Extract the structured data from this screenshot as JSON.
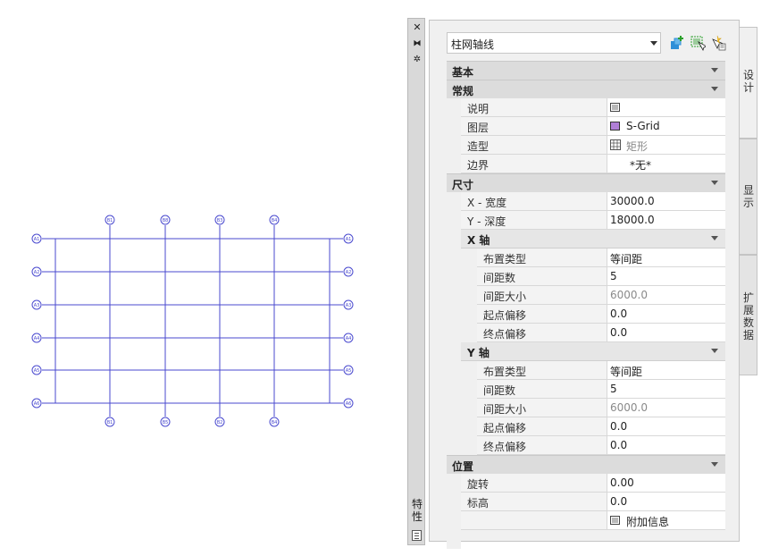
{
  "drawing": {
    "grid_top_labels": [
      "B1",
      "B8",
      "B3",
      "B4"
    ],
    "grid_bottom_labels": [
      "B1",
      "B5",
      "B2",
      "B4"
    ],
    "grid_left_labels": [
      "A1",
      "A2",
      "A3",
      "A4",
      "A5",
      "A6"
    ],
    "grid_right_labels": [
      "A1",
      "A2",
      "A3",
      "A4",
      "A5",
      "A6"
    ],
    "line_color": "#4a4acf"
  },
  "palette": {
    "title": "特性",
    "close_icon": "close-icon",
    "pin_icon": "autohide-icon",
    "options_icon": "properties-options-icon",
    "object_type": "柱网轴线",
    "header_icons": [
      "quick-select-icon",
      "select-objects-icon",
      "toggle-pickadd-icon"
    ],
    "tabs": [
      "设计",
      "显示",
      "扩展数据"
    ],
    "sections": {
      "basic": "基本",
      "general": "常规",
      "dimensions": "尺寸",
      "x_axis": "X 轴",
      "y_axis": "Y 轴",
      "location": "位置"
    },
    "general": {
      "description_label": "说明",
      "layer_label": "图层",
      "layer_value": "S-Grid",
      "layer_color": "#b07fd6",
      "shape_label": "造型",
      "shape_value": "矩形",
      "boundary_label": "边界",
      "boundary_value": "*无*"
    },
    "dimensions": {
      "width_label": "X - 宽度",
      "width_value": "30000.0",
      "depth_label": "Y - 深度",
      "depth_value": "18000.0"
    },
    "x_axis": {
      "layout_label": "布置类型",
      "layout_value": "等间距",
      "count_label": "间距数",
      "count_value": "5",
      "size_label": "间距大小",
      "size_value": "6000.0",
      "start_label": "起点偏移",
      "start_value": "0.0",
      "end_label": "终点偏移",
      "end_value": "0.0"
    },
    "y_axis": {
      "layout_label": "布置类型",
      "layout_value": "等间距",
      "count_label": "间距数",
      "count_value": "5",
      "size_label": "间距大小",
      "size_value": "6000.0",
      "start_label": "起点偏移",
      "start_value": "0.0",
      "end_label": "终点偏移",
      "end_value": "0.0"
    },
    "location": {
      "rotation_label": "旋转",
      "rotation_value": "0.00",
      "elevation_label": "标高",
      "elevation_value": "0.0",
      "extra_info": "附加信息"
    }
  }
}
